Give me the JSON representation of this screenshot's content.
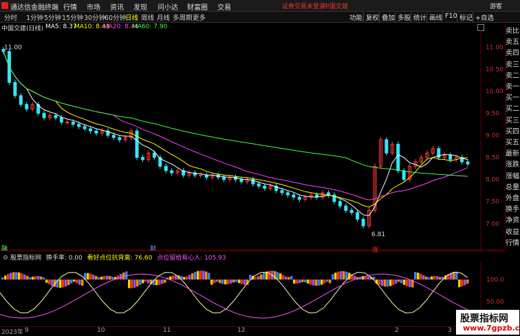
{
  "app": {
    "title": "通达信金融终端",
    "menu": [
      "行情",
      "市场",
      "资讯",
      "发现",
      "问小达",
      "财富圈",
      "交易"
    ],
    "warning": "证券交易未登录",
    "stock_top": "中国交建",
    "visitor": "游客"
  },
  "toolbar": {
    "timeframes": [
      "分时",
      "1分钟",
      "5分钟",
      "15分钟",
      "30分钟",
      "60分钟",
      "日线",
      "周线",
      "月线",
      "多周期",
      "更多"
    ],
    "active": "日线",
    "buttons": [
      "功能",
      "复权",
      "叠加",
      "多股",
      "统计",
      "画线",
      "F10",
      "标记",
      "+自选"
    ]
  },
  "main": {
    "title": "中国交建(日线)",
    "ma": [
      {
        "label": "MA5: 8.37",
        "color": "#ffffff"
      },
      {
        "label": "MA10: 8.43",
        "color": "#ffff00"
      },
      {
        "label": "MA20: 8.44",
        "color": "#ff44ff"
      },
      {
        "label": "MA60: 7.90",
        "color": "#44ff44"
      }
    ],
    "high_label": "11.00",
    "low_label": "6.81",
    "y_ticks": [
      "11.00",
      "10.50",
      "10.00",
      "9.50",
      "9.00",
      "8.50",
      "8.00",
      "7.50",
      "7.00"
    ],
    "marks": [
      "融",
      "财",
      "涨"
    ]
  },
  "right_panel": [
    "卖比",
    "卖五",
    "卖四",
    "卖三",
    "卖二",
    "卖一",
    "买一",
    "买二",
    "买三",
    "买四",
    "买五",
    "最新",
    "涨跌",
    "涨幅",
    "总量",
    "外盘",
    "换手",
    "净资",
    "收益",
    "行情"
  ],
  "sub": {
    "title": "股票指标网",
    "items": [
      {
        "label": "换手率: 0.00",
        "color": "#dddddd"
      },
      {
        "label": "看好点位抗背离: 76.60",
        "color": "#ffff00"
      },
      {
        "label": "点位留给有心人: 105.93",
        "color": "#ff55ff"
      }
    ],
    "y_ticks": [
      "100.0",
      "50.00"
    ]
  },
  "x_axis": [
    "2023年",
    "9",
    "10",
    "11",
    "12",
    "2",
    "3"
  ],
  "watermark": {
    "line1": "股票指标网",
    "line2": "www.7gpzb.com"
  },
  "chart_data": {
    "type": "candlestick",
    "title": "中国交建(日线)",
    "ylim": [
      6.7,
      11.1
    ],
    "high": 11.0,
    "low": 6.81,
    "ma_values": {
      "MA5": 8.37,
      "MA10": 8.43,
      "MA20": 8.44,
      "MA60": 7.9
    },
    "closes": [
      10.9,
      10.2,
      9.9,
      9.7,
      9.6,
      9.7,
      9.5,
      9.4,
      9.45,
      9.4,
      9.3,
      9.3,
      9.25,
      9.2,
      9.15,
      9.1,
      9.05,
      9.1,
      9.0,
      8.95,
      8.9,
      8.95,
      9.1,
      8.5,
      8.45,
      8.6,
      8.5,
      8.3,
      8.2,
      8.15,
      8.2,
      8.1,
      8.15,
      8.1,
      8.1,
      8.05,
      8.1,
      8.05,
      8.0,
      8.05,
      8.0,
      7.95,
      8.0,
      7.9,
      7.85,
      7.8,
      7.85,
      7.75,
      7.7,
      7.65,
      7.6,
      7.55,
      7.6,
      7.65,
      7.6,
      7.7,
      7.65,
      7.5,
      7.4,
      7.3,
      7.25,
      7.1,
      6.95,
      7.3,
      8.3,
      8.9,
      8.6,
      8.8,
      8.2,
      8.0,
      8.3,
      8.4,
      8.5,
      8.6,
      8.7,
      8.5,
      8.55,
      8.45,
      8.5,
      8.4,
      8.35
    ]
  }
}
